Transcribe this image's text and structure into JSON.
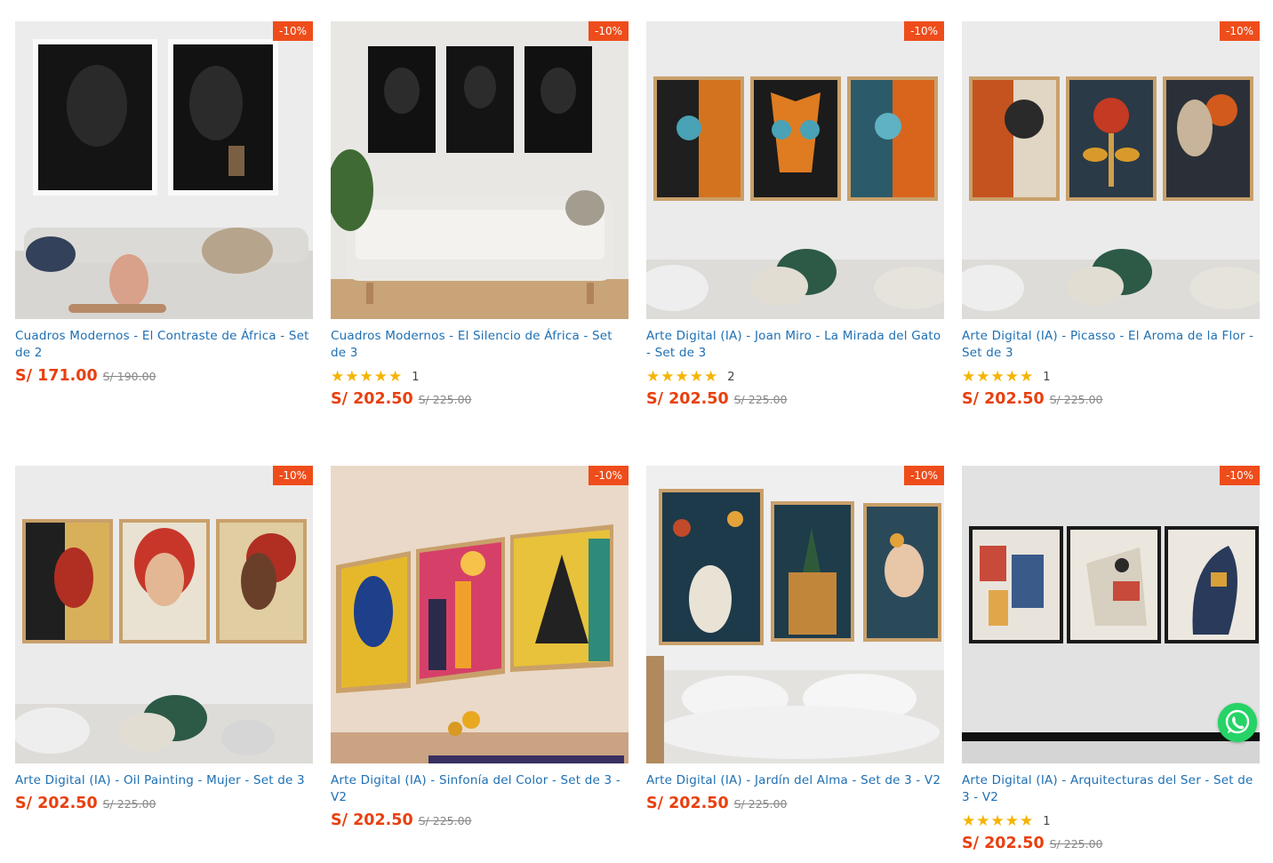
{
  "currency_symbol": "S/",
  "accent_colors": {
    "badge": "#ee4d1b",
    "price": "#e8400f",
    "title": "#1e6fb3",
    "stars": "#f5b400",
    "whatsapp": "#25d366"
  },
  "products": [
    {
      "title": "Cuadros Modernos - El Contraste de África - Set de 2",
      "badge": "-10%",
      "price": "S/ 171.00",
      "old_price": "S/ 190.00",
      "rating_stars": "",
      "rating_count": "",
      "image_icon": "two-black-portrait-canvases-living-room"
    },
    {
      "title": "Cuadros Modernos - El Silencio de África - Set de 3",
      "badge": "-10%",
      "price": "S/ 202.50",
      "old_price": "S/ 225.00",
      "rating_stars": "★★★★★",
      "rating_count": "1",
      "image_icon": "three-black-portrait-canvases-sofa"
    },
    {
      "title": "Arte Digital (IA) - Joan Miro - La Mirada del Gato - Set de 3",
      "badge": "-10%",
      "price": "S/ 202.50",
      "old_price": "S/ 225.00",
      "rating_stars": "★★★★★",
      "rating_count": "2",
      "image_icon": "three-orange-cubist-faces-cat"
    },
    {
      "title": "Arte Digital (IA) - Picasso - El Aroma de la Flor - Set de 3",
      "badge": "-10%",
      "price": "S/ 202.50",
      "old_price": "S/ 225.00",
      "rating_stars": "★★★★★",
      "rating_count": "1",
      "image_icon": "three-orange-cubist-flower-profiles"
    },
    {
      "title": "Arte Digital (IA) - Oil Painting - Mujer - Set de 3",
      "badge": "-10%",
      "price": "S/ 202.50",
      "old_price": "S/ 225.00",
      "rating_stars": "",
      "rating_count": "",
      "image_icon": "three-women-oil-painting"
    },
    {
      "title": "Arte Digital (IA) - Sinfonía del Color - Set de 3 - V2",
      "badge": "-10%",
      "price": "S/ 202.50",
      "old_price": "S/ 225.00",
      "rating_stars": "",
      "rating_count": "",
      "image_icon": "three-colorful-abstract-city"
    },
    {
      "title": "Arte Digital (IA) - Jardín del Alma - Set de 3 - V2",
      "badge": "-10%",
      "price": "S/ 202.50",
      "old_price": "S/ 225.00",
      "rating_stars": "",
      "rating_count": "",
      "image_icon": "three-deer-garden-woman"
    },
    {
      "title": "Arte Digital (IA) - Arquitecturas del Ser - Set de 3 - V2",
      "badge": "-10%",
      "price": "S/ 202.50",
      "old_price": "S/ 225.00",
      "rating_stars": "★★★★★",
      "rating_count": "1",
      "image_icon": "three-geometric-animal-canvases"
    }
  ],
  "whatsapp_icon": "whatsapp-icon"
}
